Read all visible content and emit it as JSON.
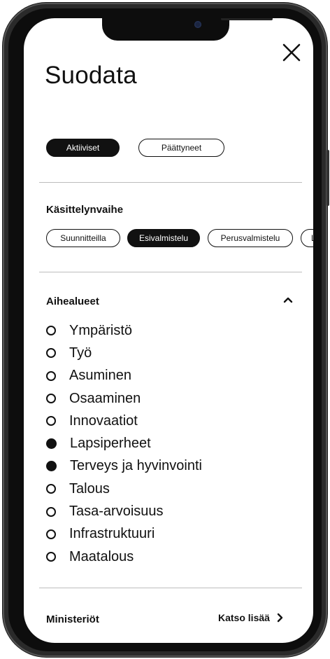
{
  "header": {
    "title": "Suodata",
    "close_icon": "close-icon"
  },
  "status_filter": {
    "options": [
      {
        "label": "Aktiiviset",
        "selected": true
      },
      {
        "label": "Päättyneet",
        "selected": false
      }
    ]
  },
  "stage": {
    "heading": "Käsittelynvaihe",
    "options": [
      {
        "label": "Suunnitteilla",
        "selected": false
      },
      {
        "label": "Esivalmistelu",
        "selected": true
      },
      {
        "label": "Perusvalmistelu",
        "selected": false
      },
      {
        "label": "L",
        "selected": false
      }
    ]
  },
  "topics": {
    "heading": "Aihealueet",
    "expanded": true,
    "toggle_icon": "chevron-up-icon",
    "items": [
      {
        "label": "Ympäristö",
        "selected": false
      },
      {
        "label": "Työ",
        "selected": false
      },
      {
        "label": "Asuminen",
        "selected": false
      },
      {
        "label": "Osaaminen",
        "selected": false
      },
      {
        "label": "Innovaatiot",
        "selected": false
      },
      {
        "label": "Lapsiperheet",
        "selected": true
      },
      {
        "label": "Terveys ja hyvinvointi",
        "selected": true
      },
      {
        "label": "Talous",
        "selected": false
      },
      {
        "label": "Tasa-arvoisuus",
        "selected": false
      },
      {
        "label": "Infrastruktuuri",
        "selected": false
      },
      {
        "label": "Maatalous",
        "selected": false
      }
    ]
  },
  "ministries": {
    "heading": "Ministeriöt",
    "see_more": "Katso lisää",
    "see_more_icon": "chevron-right-icon"
  },
  "colors": {
    "accent": "#111111",
    "background": "#ffffff",
    "divider": "#bdbdbd",
    "device_frame": "#2a2a2a"
  }
}
